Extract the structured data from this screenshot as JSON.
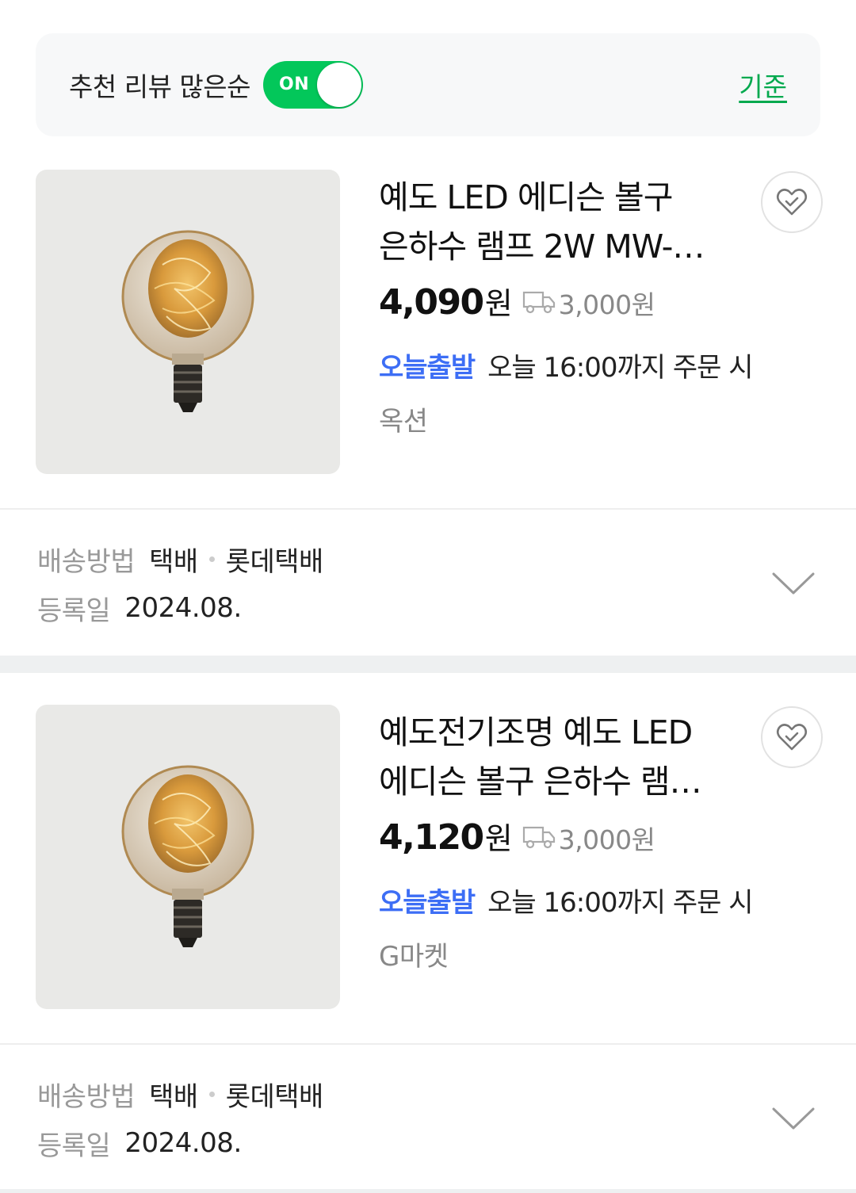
{
  "filter": {
    "label": "추천 리뷰 많은순",
    "toggle_text": "ON",
    "criteria_link": "기준"
  },
  "products": [
    {
      "title_line1": "예도 LED 에디슨 볼구",
      "title_line2": "은하수 램프 2W MW-…",
      "price": "4,090",
      "price_unit": "원",
      "shipping_fee": "3,000원",
      "delivery_badge": "오늘출발",
      "delivery_text": "오늘 16:00까지 주문 시",
      "seller": "옥션",
      "shipping_method_label": "배송방법",
      "shipping_method_value1": "택배",
      "shipping_method_value2": "롯데택배",
      "registered_label": "등록일",
      "registered_value": "2024.08."
    },
    {
      "title_line1": "예도전기조명 예도 LED",
      "title_line2": "에디슨 볼구 은하수 램…",
      "price": "4,120",
      "price_unit": "원",
      "shipping_fee": "3,000원",
      "delivery_badge": "오늘출발",
      "delivery_text": "오늘 16:00까지 주문 시",
      "seller": "G마켓",
      "shipping_method_label": "배송방법",
      "shipping_method_value1": "택배",
      "shipping_method_value2": "롯데택배",
      "registered_label": "등록일",
      "registered_value": "2024.08."
    }
  ],
  "icons": {
    "wishlist": "heart-check-icon",
    "shipping": "truck-icon",
    "expand": "chevron-down-icon"
  },
  "colors": {
    "toggle_on": "#03c75a",
    "criteria_link": "#03a94e",
    "delivery_badge": "#3d6ef5",
    "muted_text": "#888888"
  }
}
